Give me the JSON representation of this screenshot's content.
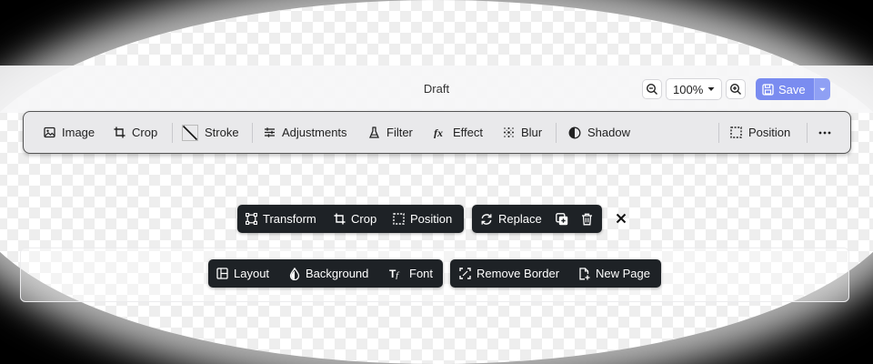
{
  "document": {
    "title": "Draft"
  },
  "zoom": {
    "level": "100%",
    "zoom_out": "zoom-out-icon",
    "zoom_in": "zoom-in-icon"
  },
  "save": {
    "label": "Save"
  },
  "toolbar": {
    "image": "Image",
    "crop": "Crop",
    "stroke": "Stroke",
    "adjustments": "Adjustments",
    "filter": "Filter",
    "effect": "Effect",
    "blur": "Blur",
    "shadow": "Shadow",
    "position": "Position"
  },
  "floating_toolbar_1": {
    "transform": "Transform",
    "crop": "Crop",
    "position": "Position"
  },
  "floating_toolbar_2": {
    "replace": "Replace"
  },
  "floating_toolbar_3": {
    "layout": "Layout",
    "background": "Background",
    "font": "Font"
  },
  "floating_toolbar_4": {
    "remove_border": "Remove Border",
    "new_page": "New Page"
  },
  "colors": {
    "accent": "#7a8cf0",
    "dark_pill": "#1e2226",
    "toolbar_bg": "#e9e9eb"
  }
}
